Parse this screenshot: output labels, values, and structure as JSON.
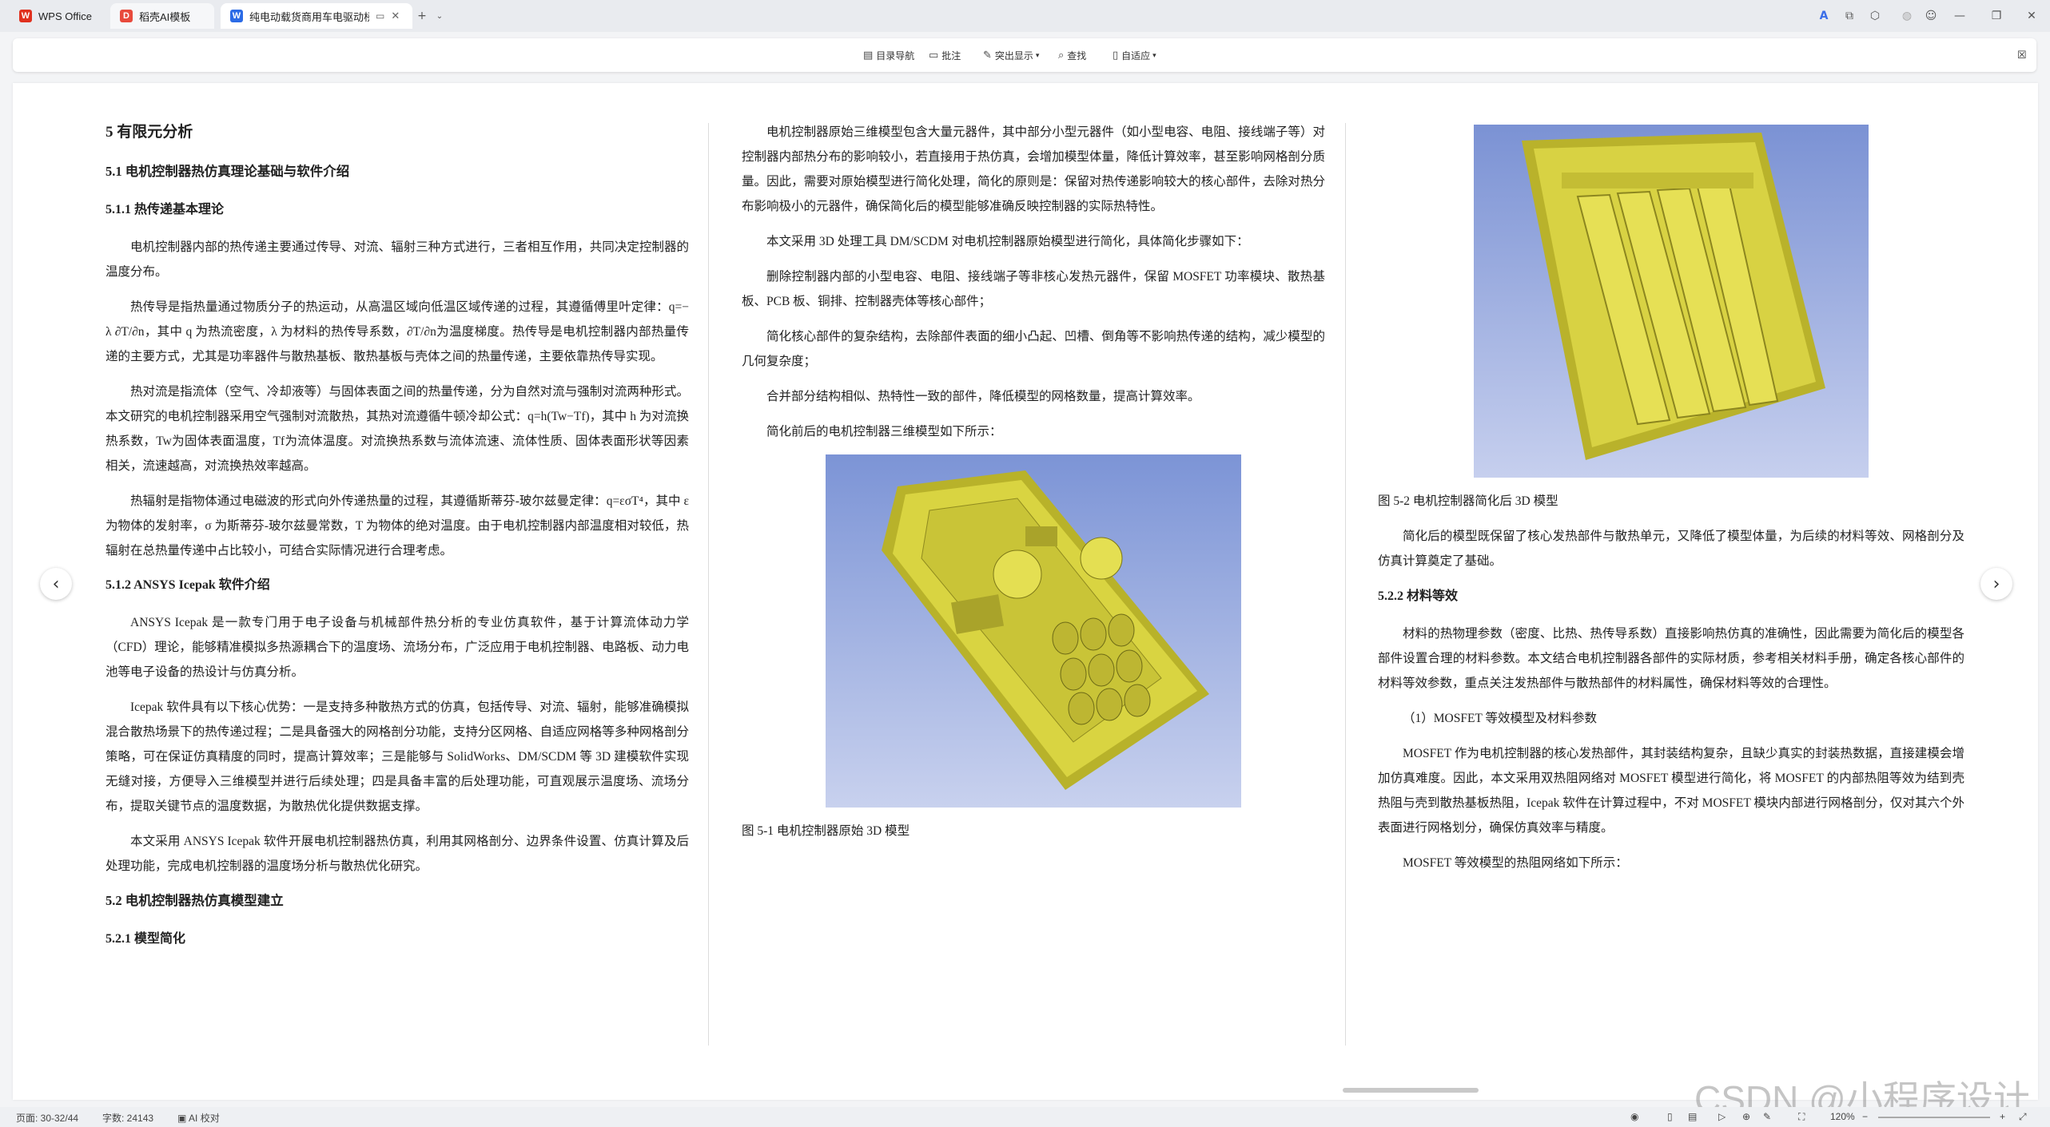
{
  "titlebar": {
    "tabs": [
      {
        "label": "WPS Office",
        "icon": "wps-logo-icon"
      },
      {
        "label": "稻壳AI模板",
        "icon": "docer-logo-icon"
      },
      {
        "label": "纯电动载货商用车电驱动桥系",
        "icon": "word-doc-icon"
      }
    ],
    "new_tab": "+"
  },
  "toolbar": {
    "nav": "目录导航",
    "comment": "批注",
    "highlight": "突出显示",
    "find": "查找",
    "fit": "自适应"
  },
  "col1": {
    "h_5": "5 有限元分析",
    "h_51": "5.1 电机控制器热仿真理论基础与软件介绍",
    "h_511": "5.1.1 热传递基本理论",
    "p1": "电机控制器内部的热传递主要通过传导、对流、辐射三种方式进行，三者相互作用，共同决定控制器的温度分布。",
    "p2": "热传导是指热量通过物质分子的热运动，从高温区域向低温区域传递的过程，其遵循傅里叶定律：q=− λ ∂T/∂n，其中 q 为热流密度，λ 为材料的热传导系数，∂T/∂n为温度梯度。热传导是电机控制器内部热量传递的主要方式，尤其是功率器件与散热基板、散热基板与壳体之间的热量传递，主要依靠热传导实现。",
    "p3": "热对流是指流体（空气、冷却液等）与固体表面之间的热量传递，分为自然对流与强制对流两种形式。本文研究的电机控制器采用空气强制对流散热，其热对流遵循牛顿冷却公式：q=h(Tw−Tf)，其中 h 为对流换热系数，Tw为固体表面温度，Tf为流体温度。对流换热系数与流体流速、流体性质、固体表面形状等因素相关，流速越高，对流换热效率越高。",
    "p4": "热辐射是指物体通过电磁波的形式向外传递热量的过程，其遵循斯蒂芬-玻尔兹曼定律：q=εσT⁴，其中 ε 为物体的发射率，σ 为斯蒂芬-玻尔兹曼常数，T 为物体的绝对温度。由于电机控制器内部温度相对较低，热辐射在总热量传递中占比较小，可结合实际情况进行合理考虑。",
    "h_512": "5.1.2 ANSYS Icepak 软件介绍",
    "p5": "ANSYS Icepak 是一款专门用于电子设备与机械部件热分析的专业仿真软件，基于计算流体动力学（CFD）理论，能够精准模拟多热源耦合下的温度场、流场分布，广泛应用于电机控制器、电路板、动力电池等电子设备的热设计与仿真分析。",
    "p6": "Icepak 软件具有以下核心优势：一是支持多种散热方式的仿真，包括传导、对流、辐射，能够准确模拟混合散热场景下的热传递过程；二是具备强大的网格剖分功能，支持分区网格、自适应网格等多种网格剖分策略，可在保证仿真精度的同时，提高计算效率；三是能够与 SolidWorks、DM/SCDM 等 3D 建模软件实现无缝对接，方便导入三维模型并进行后续处理；四是具备丰富的后处理功能，可直观展示温度场、流场分布，提取关键节点的温度数据，为散热优化提供数据支撑。",
    "p7": "本文采用 ANSYS Icepak 软件开展电机控制器热仿真，利用其网格剖分、边界条件设置、仿真计算及后处理功能，完成电机控制器的温度场分析与散热优化研究。",
    "h_52": "5.2 电机控制器热仿真模型建立",
    "h_521": "5.2.1 模型简化"
  },
  "col2": {
    "p1": "电机控制器原始三维模型包含大量元器件，其中部分小型元器件（如小型电容、电阻、接线端子等）对控制器内部热分布的影响较小，若直接用于热仿真，会增加模型体量，降低计算效率，甚至影响网格剖分质量。因此，需要对原始模型进行简化处理，简化的原则是：保留对热传递影响较大的核心部件，去除对热分布影响极小的元器件，确保简化后的模型能够准确反映控制器的实际热特性。",
    "p2": "本文采用 3D 处理工具 DM/SCDM 对电机控制器原始模型进行简化，具体简化步骤如下：",
    "p3": "删除控制器内部的小型电容、电阻、接线端子等非核心发热元器件，保留 MOSFET 功率模块、散热基板、PCB 板、铜排、控制器壳体等核心部件；",
    "p4": "简化核心部件的复杂结构，去除部件表面的细小凸起、凹槽、倒角等不影响热传递的结构，减少模型的几何复杂度；",
    "p5": "合并部分结构相似、热特性一致的部件，降低模型的网格数量，提高计算效率。",
    "p6": "简化前后的电机控制器三维模型如下所示：",
    "fig1_caption": "图 5-1 电机控制器原始 3D 模型"
  },
  "col3": {
    "fig2_caption": "图 5-2 电机控制器简化后 3D 模型",
    "p1": "简化后的模型既保留了核心发热部件与散热单元，又降低了模型体量，为后续的材料等效、网格剖分及仿真计算奠定了基础。",
    "h_522": "5.2.2 材料等效",
    "p2": "材料的热物理参数（密度、比热、热传导系数）直接影响热仿真的准确性，因此需要为简化后的模型各部件设置合理的材料参数。本文结合电机控制器各部件的实际材质，参考相关材料手册，确定各核心部件的材料等效参数，重点关注发热部件与散热部件的材料属性，确保材料等效的合理性。",
    "p3": "（1）MOSFET 等效模型及材料参数",
    "p4": "MOSFET 作为电机控制器的核心发热部件，其封装结构复杂，且缺少真实的封装热数据，直接建模会增加仿真难度。因此，本文采用双热阻网络对 MOSFET 模型进行简化，将 MOSFET 的内部热阻等效为结到壳热阻与壳到散热基板热阻，Icepak 软件在计算过程中，不对 MOSFET 模块内部进行网格剖分，仅对其六个外表面进行网格划分，确保仿真效率与精度。",
    "p5": "MOSFET 等效模型的热阻网络如下所示："
  },
  "statusbar": {
    "pages": "页面: 30-32/44",
    "words": "字数: 24143",
    "proof": "AI 校对",
    "zoom": "120%"
  },
  "watermark": "CSDN @小程序设计"
}
